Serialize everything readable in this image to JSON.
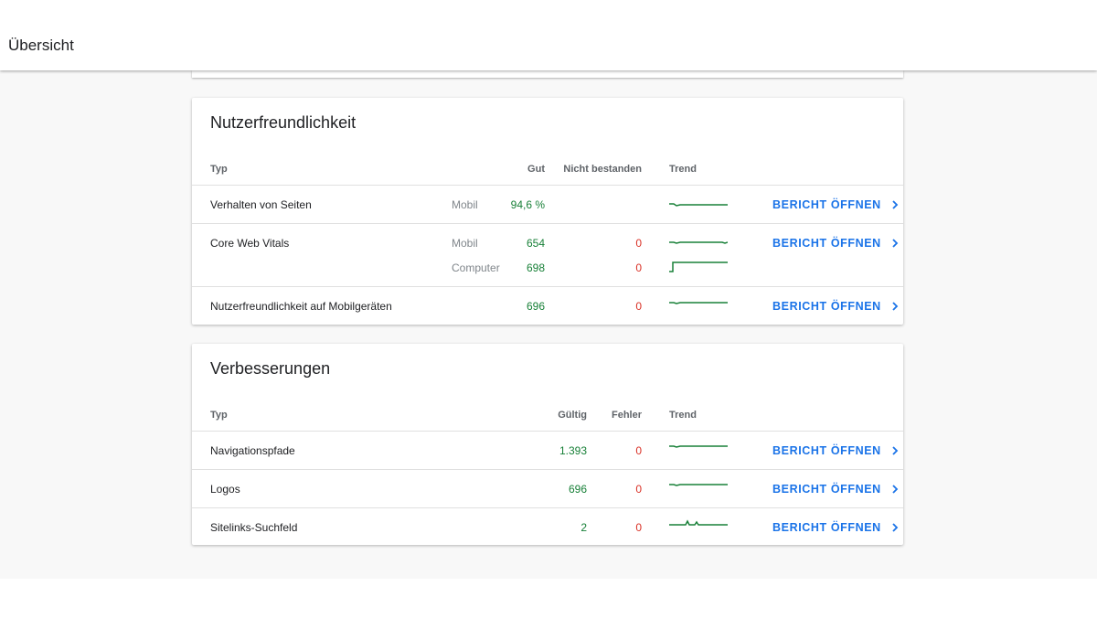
{
  "header": {
    "title": "Übersicht"
  },
  "usability": {
    "title": "Nutzerfreundlichkeit",
    "columns": {
      "type": "Typ",
      "good": "Gut",
      "failed": "Nicht bestanden",
      "trend": "Trend"
    },
    "rows": [
      {
        "label": "Verhalten von Seiten",
        "device": "Mobil",
        "good": "94,6 %",
        "failed": "",
        "link": "BERICHT ÖFFNEN"
      },
      {
        "label": "Core Web Vitals",
        "device": "Mobil",
        "good": "654",
        "failed": "0",
        "link": "BERICHT ÖFFNEN",
        "device2": "Computer",
        "good2": "698",
        "failed2": "0"
      },
      {
        "label": "Nutzerfreundlichkeit auf Mobilgeräten",
        "good": "696",
        "failed": "0",
        "link": "BERICHT ÖFFNEN"
      }
    ]
  },
  "enhancements": {
    "title": "Verbesserungen",
    "columns": {
      "type": "Typ",
      "valid": "Gültig",
      "errors": "Fehler",
      "trend": "Trend"
    },
    "rows": [
      {
        "label": "Navigationspfade",
        "valid": "1.393",
        "errors": "0",
        "link": "BERICHT ÖFFNEN"
      },
      {
        "label": "Logos",
        "valid": "696",
        "errors": "0",
        "link": "BERICHT ÖFFNEN"
      },
      {
        "label": "Sitelinks-Suchfeld",
        "valid": "2",
        "errors": "0",
        "link": "BERICHT ÖFFNEN"
      }
    ]
  },
  "colors": {
    "good": "#188038",
    "bad": "#d93025",
    "link": "#1a73e8",
    "trend": "#188038"
  },
  "icons": {
    "link_chevron": "chevron-right-icon"
  }
}
